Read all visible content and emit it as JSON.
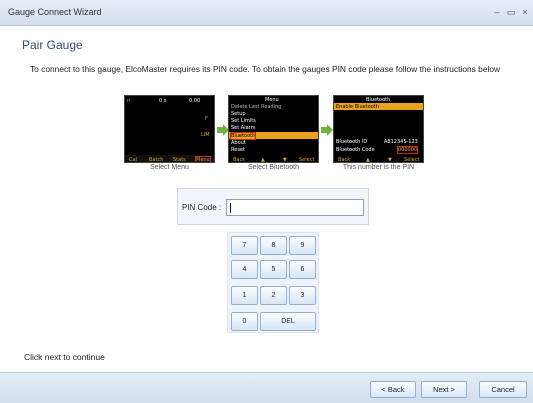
{
  "window": {
    "title": "Gauge Connect Wizard",
    "controls": {
      "minimize": "–",
      "maximize": "▭",
      "close": "×"
    }
  },
  "page": {
    "heading": "Pair Gauge",
    "instructions": "To connect to this gauge, ElcoMaster requires its PIN code. To obtain the gauges PIN code please follow the instructions below",
    "hint": "Click next to continue"
  },
  "steps": [
    {
      "caption": "Select Menu",
      "screen": {
        "top_left": "n",
        "top_mid": "0 s",
        "top_right": "0.00",
        "side_f": "F",
        "side_lim": "LIM",
        "softkeys": [
          "Cal",
          "Batch",
          "Stats",
          "Menu"
        ]
      }
    },
    {
      "caption": "Select Bluetooth",
      "screen": {
        "header": "Menu",
        "items": [
          "Delete Last Reading",
          "Setup",
          "Set Limits",
          "Set Alarm",
          "Bluetooth",
          "About",
          "Reset"
        ],
        "softkeys": [
          "Back",
          "▲",
          "▼",
          "Select"
        ]
      }
    },
    {
      "caption": "This number is the PIN",
      "screen": {
        "header": "Bluetooth",
        "item": "Enable Bluetooth",
        "id_label": "Bluetooth ID",
        "id_value": "A812345-123",
        "code_label": "Bluetooth Code",
        "code_value": "000000",
        "softkeys": [
          "Back",
          "▲",
          "▼",
          "Select"
        ]
      }
    }
  ],
  "pin": {
    "label": "PIN Code :",
    "value": ""
  },
  "keypad": {
    "keys": [
      "7",
      "8",
      "9",
      "4",
      "5",
      "6",
      "1",
      "2",
      "3",
      "0"
    ],
    "del": "DEL"
  },
  "footer": {
    "back": "< Back",
    "next": "Next >",
    "cancel": "Cancel"
  },
  "colors": {
    "accent": "#2a4f7a",
    "highlight": "#e7a319",
    "arrow": "#6fb53b",
    "marker": "#d0202a"
  }
}
